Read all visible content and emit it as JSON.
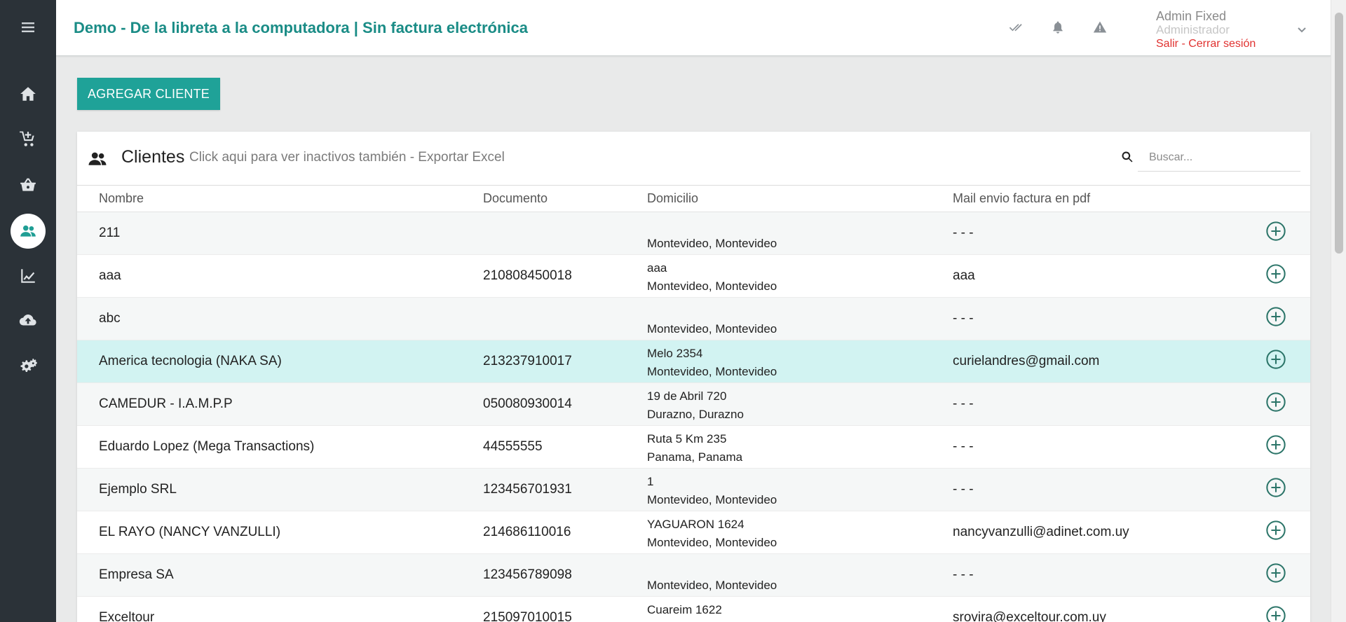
{
  "header": {
    "title": "Demo - De la libreta a la computadora | Sin factura electrónica",
    "user_name": "Admin Fixed",
    "user_role": "Administrador",
    "logout_label": "Salir - Cerrar sesión"
  },
  "toolbar": {
    "add_client_label": "AGREGAR CLIENTE"
  },
  "card": {
    "title": "Clientes",
    "subtitle": "Click aqui para ver inactivos también - Exportar Excel",
    "search_placeholder": "Buscar..."
  },
  "table": {
    "columns": [
      "Nombre",
      "Documento",
      "Domicilio",
      "Mail envio factura en pdf"
    ],
    "rows": [
      {
        "nombre": "211",
        "documento": "",
        "direccion": "",
        "ciudad": "Montevideo, Montevideo",
        "mail": "- - -"
      },
      {
        "nombre": "aaa",
        "documento": "210808450018",
        "direccion": "aaa",
        "ciudad": "Montevideo, Montevideo",
        "mail": "aaa"
      },
      {
        "nombre": "abc",
        "documento": "",
        "direccion": "",
        "ciudad": "Montevideo, Montevideo",
        "mail": "- - -"
      },
      {
        "nombre": "America tecnologia (NAKA SA)",
        "documento": "213237910017",
        "direccion": "Melo 2354",
        "ciudad": "Montevideo, Montevideo",
        "mail": "curielandres@gmail.com"
      },
      {
        "nombre": "CAMEDUR - I.A.M.P.P",
        "documento": "050080930014",
        "direccion": "19 de Abril 720",
        "ciudad": "Durazno, Durazno",
        "mail": "- - -"
      },
      {
        "nombre": "Eduardo Lopez (Mega Transactions)",
        "documento": "44555555",
        "direccion": "Ruta 5 Km 235",
        "ciudad": "Panama, Panama",
        "mail": "- - -"
      },
      {
        "nombre": "Ejemplo SRL",
        "documento": "123456701931",
        "direccion": "1",
        "ciudad": "Montevideo, Montevideo",
        "mail": "- - -"
      },
      {
        "nombre": "EL RAYO (NANCY VANZULLI)",
        "documento": "214686110016",
        "direccion": "YAGUARON 1624",
        "ciudad": "Montevideo, Montevideo",
        "mail": "nancyvanzulli@adinet.com.uy"
      },
      {
        "nombre": "Empresa SA",
        "documento": "123456789098",
        "direccion": "",
        "ciudad": "Montevideo, Montevideo",
        "mail": "- - -"
      },
      {
        "nombre": "Exceltour",
        "documento": "215097010015",
        "direccion": "Cuareim 1622",
        "ciudad": "",
        "mail": "srovira@exceltour.com.uy"
      }
    ]
  },
  "sidebar": {
    "items": [
      {
        "icon": "home-icon"
      },
      {
        "icon": "cart-add-icon"
      },
      {
        "icon": "basket-icon"
      },
      {
        "icon": "users-icon",
        "active": true
      },
      {
        "icon": "chart-line-icon"
      },
      {
        "icon": "cloud-upload-icon"
      },
      {
        "icon": "gears-icon"
      }
    ]
  },
  "colors": {
    "accent": "#1fa298",
    "title": "#1a8c86",
    "sidebar": "#2b3238",
    "highlight_row": "#d2f3f2",
    "logout": "#e0312f"
  }
}
